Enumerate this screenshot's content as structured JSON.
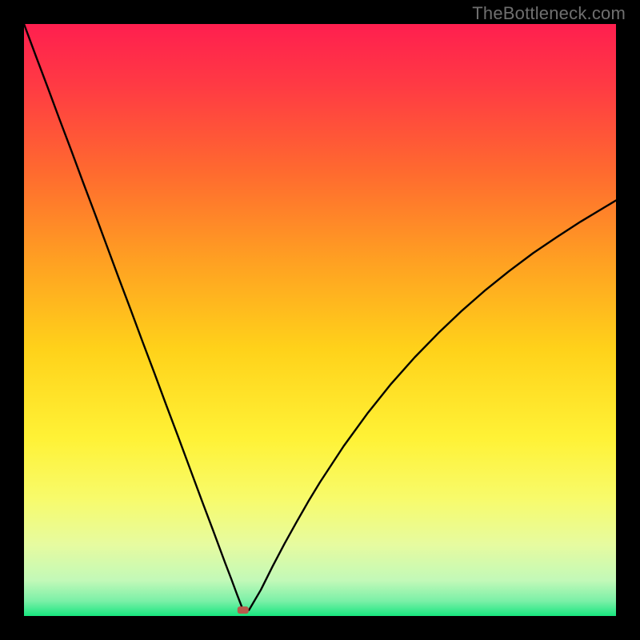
{
  "watermark": {
    "text": "TheBottleneck.com"
  },
  "chart_data": {
    "type": "line",
    "title": "",
    "xlabel": "",
    "ylabel": "",
    "xlim": [
      0,
      100
    ],
    "ylim": [
      0,
      100
    ],
    "x": [
      0,
      2,
      4,
      6,
      8,
      10,
      12,
      14,
      16,
      18,
      20,
      22,
      24,
      26,
      28,
      30,
      32,
      34,
      35,
      36,
      37,
      38,
      40,
      42,
      44,
      46,
      48,
      50,
      54,
      58,
      62,
      66,
      70,
      74,
      78,
      82,
      86,
      90,
      94,
      98,
      100
    ],
    "values": [
      100,
      94.6,
      89.3,
      83.9,
      78.6,
      73.2,
      67.9,
      62.5,
      57.1,
      51.8,
      46.4,
      41.1,
      35.7,
      30.4,
      25.0,
      19.6,
      14.3,
      8.9,
      6.3,
      3.6,
      1.0,
      1.0,
      4.4,
      8.4,
      12.2,
      15.8,
      19.3,
      22.6,
      28.7,
      34.2,
      39.2,
      43.7,
      47.8,
      51.6,
      55.1,
      58.3,
      61.3,
      64.0,
      66.6,
      69.0,
      70.2
    ],
    "background_gradient": {
      "stops": [
        {
          "offset": 0.0,
          "color": "#ff1f4f"
        },
        {
          "offset": 0.1,
          "color": "#ff3944"
        },
        {
          "offset": 0.25,
          "color": "#ff6a2f"
        },
        {
          "offset": 0.4,
          "color": "#ffa022"
        },
        {
          "offset": 0.55,
          "color": "#ffd21a"
        },
        {
          "offset": 0.7,
          "color": "#fff236"
        },
        {
          "offset": 0.8,
          "color": "#f8fb6a"
        },
        {
          "offset": 0.88,
          "color": "#e6fba0"
        },
        {
          "offset": 0.94,
          "color": "#c2f9b8"
        },
        {
          "offset": 0.975,
          "color": "#7af0a7"
        },
        {
          "offset": 1.0,
          "color": "#18e67f"
        }
      ]
    },
    "marker": {
      "x": 37,
      "y": 1.0,
      "color": "#b85a4b"
    },
    "annotations": []
  }
}
